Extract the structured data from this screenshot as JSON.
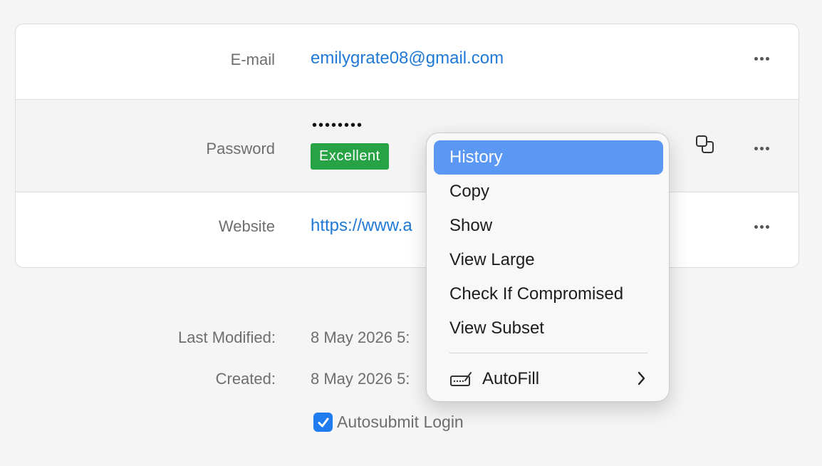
{
  "fields": {
    "email": {
      "label": "E-mail",
      "value": "emilygrate08@gmail.com"
    },
    "password": {
      "label": "Password",
      "masked": "••••••••",
      "strength": "Excellent"
    },
    "website": {
      "label": "Website",
      "value": "https://www.a"
    }
  },
  "meta": {
    "last_modified_label": "Last Modified:",
    "last_modified_value": "8 May 2026 5:",
    "created_label": "Created:",
    "created_value": "8 May 2026 5:"
  },
  "autosubmit": {
    "label": "Autosubmit Login",
    "checked": true
  },
  "context_menu": {
    "items": [
      {
        "label": "History",
        "active": true
      },
      {
        "label": "Copy"
      },
      {
        "label": "Show"
      },
      {
        "label": "View Large"
      },
      {
        "label": "Check If Compromised"
      },
      {
        "label": "View Subset"
      }
    ],
    "autofill": {
      "label": "AutoFill",
      "icon": "autofill-icon"
    }
  },
  "icons": {
    "more": "ellipsis-icon",
    "copy": "copy-icon",
    "chevron": "chevron-right-icon",
    "check": "checkmark-icon"
  },
  "colors": {
    "link": "#2079d6",
    "strength_badge": "#27a244",
    "menu_highlight": "#5b98f3",
    "checkbox": "#1e7bf0"
  }
}
